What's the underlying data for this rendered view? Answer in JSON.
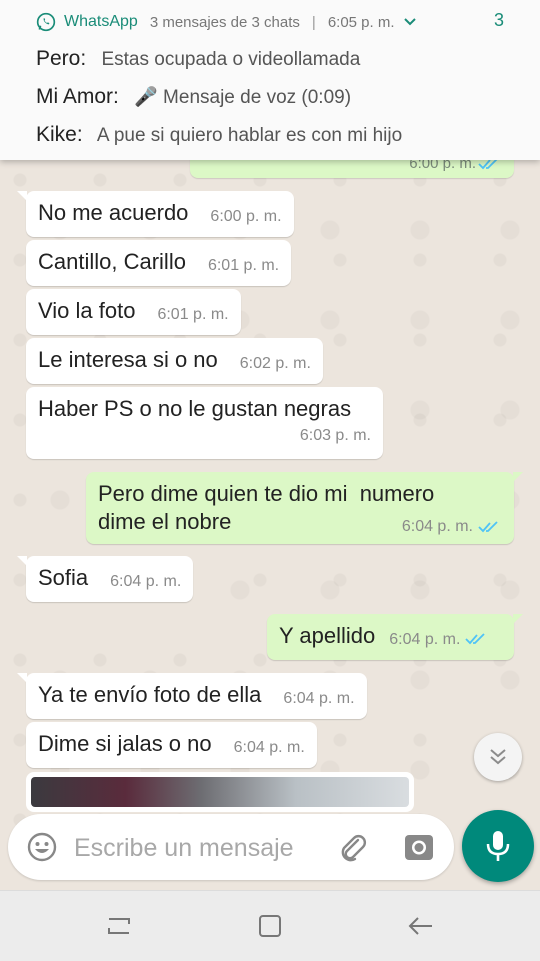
{
  "notification": {
    "app_name": "WhatsApp",
    "summary": "3 mensajes de 3 chats",
    "separator": "|",
    "time": "6:05 p. m.",
    "count": "3",
    "lines": [
      {
        "sender": "Pero:",
        "message": "Estas ocupada o videollamada"
      },
      {
        "sender": "Mi Amor:",
        "message": "🎤 Mensaje de voz (0:09)"
      },
      {
        "sender": "Kike:",
        "message": "A pue si quiero hablar es con mi hijo"
      }
    ]
  },
  "partial_message": {
    "time": "6:00 p. m."
  },
  "messages": [
    {
      "dir": "in",
      "text": "No me acuerdo",
      "time": "6:00 p. m."
    },
    {
      "dir": "in",
      "text": "Cantillo, Carillo",
      "time": "6:01 p. m."
    },
    {
      "dir": "in",
      "text": "Vio la foto",
      "time": "6:01 p. m."
    },
    {
      "dir": "in",
      "text": "Le interesa si o no",
      "time": "6:02 p. m."
    },
    {
      "dir": "in",
      "text": "Haber PS o no le gustan negras",
      "time": "6:03 p. m."
    },
    {
      "dir": "out",
      "text": "Pero dime quien te dio mi  numero\ndime el nobre",
      "time": "6:04 p. m."
    },
    {
      "dir": "in",
      "text": "Sofia",
      "time": "6:04 p. m."
    },
    {
      "dir": "out",
      "text": "Y apellido",
      "time": "6:04 p. m."
    },
    {
      "dir": "in",
      "text": "Ya te envío foto de ella",
      "time": "6:04 p. m."
    },
    {
      "dir": "in",
      "text": "Dime si jalas o no",
      "time": "6:04 p. m."
    }
  ],
  "composer": {
    "placeholder": "Escribe un mensaje"
  },
  "colors": {
    "accent": "#00897b",
    "outgoing": "#dcf8c6",
    "ticks": "#4fc3f7"
  }
}
